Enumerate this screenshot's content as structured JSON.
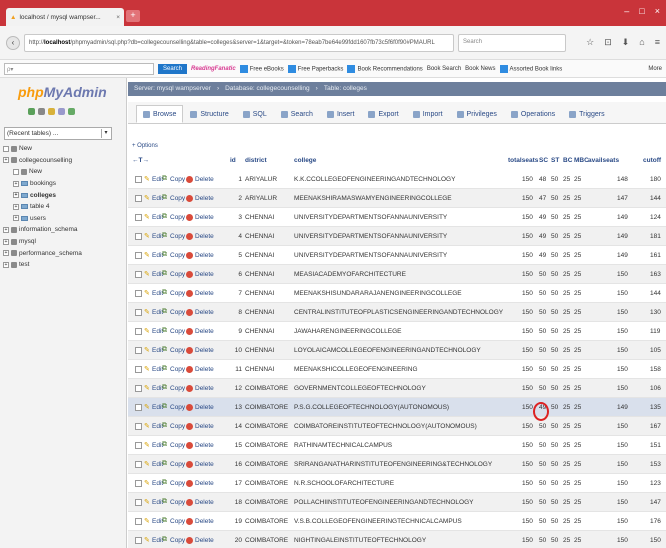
{
  "browser": {
    "tab_title": "localhost / mysql wampser...",
    "tab_close": "×",
    "new_tab": "+",
    "window_controls": [
      "–",
      "□",
      "×"
    ],
    "url_prefix": "http://",
    "url_host": "localhost",
    "url_rest": "/phpmyadmin/sql.php?db=collegecounselling&table=colleges&server=1&target=&token=78eab7be64e99fdd1607fb73c5f6f0f90#PMAURL",
    "search_placeholder": "Search",
    "nav_icons": [
      "☆",
      "⊡",
      "⬇",
      "⌂",
      "≡"
    ]
  },
  "bookmarks": {
    "input_placeholder": "ρ▾",
    "search_label": "Search",
    "brand": "ReadingFanatic",
    "items": [
      "Free eBooks",
      "Free Paperbacks",
      "Book Recommendations",
      "Book Search",
      "Book News",
      "Assorted Book links"
    ],
    "more": "More"
  },
  "sidebar": {
    "logo_php": "php",
    "logo_myadmin": "MyAdmin",
    "recent_label": "(Recent tables) ...",
    "tree": [
      {
        "label": "New",
        "level": 0,
        "kind": "new"
      },
      {
        "label": "collegecounselling",
        "level": 0,
        "kind": "db"
      },
      {
        "label": "New",
        "level": 1,
        "kind": "new"
      },
      {
        "label": "bookings",
        "level": 1,
        "kind": "table"
      },
      {
        "label": "colleges",
        "level": 1,
        "kind": "table",
        "selected": true
      },
      {
        "label": "table 4",
        "level": 1,
        "kind": "table"
      },
      {
        "label": "users",
        "level": 1,
        "kind": "table"
      },
      {
        "label": "information_schema",
        "level": 0,
        "kind": "db"
      },
      {
        "label": "mysql",
        "level": 0,
        "kind": "db"
      },
      {
        "label": "performance_schema",
        "level": 0,
        "kind": "db"
      },
      {
        "label": "test",
        "level": 0,
        "kind": "db"
      }
    ]
  },
  "breadcrumb": [
    "Server: mysql wampserver",
    "Database: collegecounselling",
    "Table: colleges"
  ],
  "tabs": [
    {
      "label": "Browse",
      "active": true
    },
    {
      "label": "Structure"
    },
    {
      "label": "SQL"
    },
    {
      "label": "Search"
    },
    {
      "label": "Insert"
    },
    {
      "label": "Export"
    },
    {
      "label": "Import"
    },
    {
      "label": "Privileges"
    },
    {
      "label": "Operations"
    },
    {
      "label": "Triggers"
    }
  ],
  "options_label": "+ Options",
  "sort_arrows": "←T→",
  "actions": {
    "edit": "Edit",
    "copy": "Copy",
    "delete": "Delete"
  },
  "columns": [
    "id",
    "district",
    "college",
    "totalseats",
    "SC",
    "ST",
    "BC",
    "MBC",
    "availseats",
    "cutoff"
  ],
  "rows": [
    {
      "id": "1",
      "district": "ARIYALUR",
      "college": "K.K.CCOLLEGEOFENGINEERINGANDTECHNOLOGY",
      "totalseats": "150",
      "SC": "48",
      "ST": "50",
      "BC": "25",
      "MBC": "25",
      "availseats": "148",
      "cutoff": "180"
    },
    {
      "id": "2",
      "district": "ARIYALUR",
      "college": "MEENAKSHIRAMASWAMYENGINEERINGCOLLEGE",
      "totalseats": "150",
      "SC": "47",
      "ST": "50",
      "BC": "25",
      "MBC": "25",
      "availseats": "147",
      "cutoff": "144"
    },
    {
      "id": "3",
      "district": "CHENNAI",
      "college": "UNIVERSITYDEPARTMENTSOFANNAUNIVERSITY",
      "totalseats": "150",
      "SC": "49",
      "ST": "50",
      "BC": "25",
      "MBC": "25",
      "availseats": "149",
      "cutoff": "124"
    },
    {
      "id": "4",
      "district": "CHENNAI",
      "college": "UNIVERSITYDEPARTMENTSOFANNAUNIVERSITY",
      "totalseats": "150",
      "SC": "49",
      "ST": "50",
      "BC": "25",
      "MBC": "25",
      "availseats": "149",
      "cutoff": "181"
    },
    {
      "id": "5",
      "district": "CHENNAI",
      "college": "UNIVERSITYDEPARTMENTSOFANNAUNIVERSITY",
      "totalseats": "150",
      "SC": "49",
      "ST": "50",
      "BC": "25",
      "MBC": "25",
      "availseats": "149",
      "cutoff": "161"
    },
    {
      "id": "6",
      "district": "CHENNAI",
      "college": "MEASIACADEMYOFARCHITECTURE",
      "totalseats": "150",
      "SC": "50",
      "ST": "50",
      "BC": "25",
      "MBC": "25",
      "availseats": "150",
      "cutoff": "163"
    },
    {
      "id": "7",
      "district": "CHENNAI",
      "college": "MEENAKSHISUNDARARAJANENGINEERINGCOLLEGE",
      "totalseats": "150",
      "SC": "50",
      "ST": "50",
      "BC": "25",
      "MBC": "25",
      "availseats": "150",
      "cutoff": "144"
    },
    {
      "id": "8",
      "district": "CHENNAI",
      "college": "CENTRALINSTITUTEOFPLASTICSENGINEERINGANDTECHNOLOGY",
      "totalseats": "150",
      "SC": "50",
      "ST": "50",
      "BC": "25",
      "MBC": "25",
      "availseats": "150",
      "cutoff": "130"
    },
    {
      "id": "9",
      "district": "CHENNAI",
      "college": "JAWAHARENGINEERINGCOLLEGE",
      "totalseats": "150",
      "SC": "50",
      "ST": "50",
      "BC": "25",
      "MBC": "25",
      "availseats": "150",
      "cutoff": "119"
    },
    {
      "id": "10",
      "district": "CHENNAI",
      "college": "LOYOLAICAMCOLLEGEOFENGINEERINGANDTECHNOLOGY",
      "totalseats": "150",
      "SC": "50",
      "ST": "50",
      "BC": "25",
      "MBC": "25",
      "availseats": "150",
      "cutoff": "105"
    },
    {
      "id": "11",
      "district": "CHENNAI",
      "college": "MEENAKSHICOLLEGEOFENGINEERING",
      "totalseats": "150",
      "SC": "50",
      "ST": "50",
      "BC": "25",
      "MBC": "25",
      "availseats": "150",
      "cutoff": "158"
    },
    {
      "id": "12",
      "district": "COIMBATORE",
      "college": "GOVERNMENTCOLLEGEOFTECHNOLOGY",
      "totalseats": "150",
      "SC": "50",
      "ST": "50",
      "BC": "25",
      "MBC": "25",
      "availseats": "150",
      "cutoff": "106"
    },
    {
      "id": "13",
      "district": "COIMBATORE",
      "college": "P.S.G.COLLEGEOFTECHNOLOGY(AUTONOMOUS)",
      "totalseats": "150",
      "SC": "49",
      "ST": "50",
      "BC": "25",
      "MBC": "25",
      "availseats": "149",
      "cutoff": "135",
      "highlight": true
    },
    {
      "id": "14",
      "district": "COIMBATORE",
      "college": "COIMBATOREINSTITUTEOFTECHNOLOGY(AUTONOMOUS)",
      "totalseats": "150",
      "SC": "50",
      "ST": "50",
      "BC": "25",
      "MBC": "25",
      "availseats": "150",
      "cutoff": "167"
    },
    {
      "id": "15",
      "district": "COIMBATORE",
      "college": "RATHINAMTECHNICALCAMPUS",
      "totalseats": "150",
      "SC": "50",
      "ST": "50",
      "BC": "25",
      "MBC": "25",
      "availseats": "150",
      "cutoff": "151"
    },
    {
      "id": "16",
      "district": "COIMBATORE",
      "college": "SRIRANGANATHARINSTITUTEOFENGINEERING&TECHNOLOGY",
      "totalseats": "150",
      "SC": "50",
      "ST": "50",
      "BC": "25",
      "MBC": "25",
      "availseats": "150",
      "cutoff": "153"
    },
    {
      "id": "17",
      "district": "COIMBATORE",
      "college": "N.R.SCHOOLOFARCHITECTURE",
      "totalseats": "150",
      "SC": "50",
      "ST": "50",
      "BC": "25",
      "MBC": "25",
      "availseats": "150",
      "cutoff": "123"
    },
    {
      "id": "18",
      "district": "COIMBATORE",
      "college": "POLLACHIINSTITUTEOFENGINEERINGANDTECHNOLOGY",
      "totalseats": "150",
      "SC": "50",
      "ST": "50",
      "BC": "25",
      "MBC": "25",
      "availseats": "150",
      "cutoff": "147"
    },
    {
      "id": "19",
      "district": "COIMBATORE",
      "college": "V.S.B.COLLEGEOFENGINEERINGTECHNICALCAMPUS",
      "totalseats": "150",
      "SC": "50",
      "ST": "50",
      "BC": "25",
      "MBC": "25",
      "availseats": "150",
      "cutoff": "176"
    },
    {
      "id": "20",
      "district": "COIMBATORE",
      "college": "NIGHTINGALEINSTITUTEOFTECHNOLOGY",
      "totalseats": "150",
      "SC": "50",
      "ST": "50",
      "BC": "25",
      "MBC": "25",
      "availseats": "150",
      "cutoff": "150"
    }
  ],
  "colors": {
    "tabbar": "#c9343a",
    "crumb": "#6d7f9c",
    "link": "#2a4a86",
    "highlight_row": "#d9e0ec",
    "annotation": "#dd2222"
  }
}
